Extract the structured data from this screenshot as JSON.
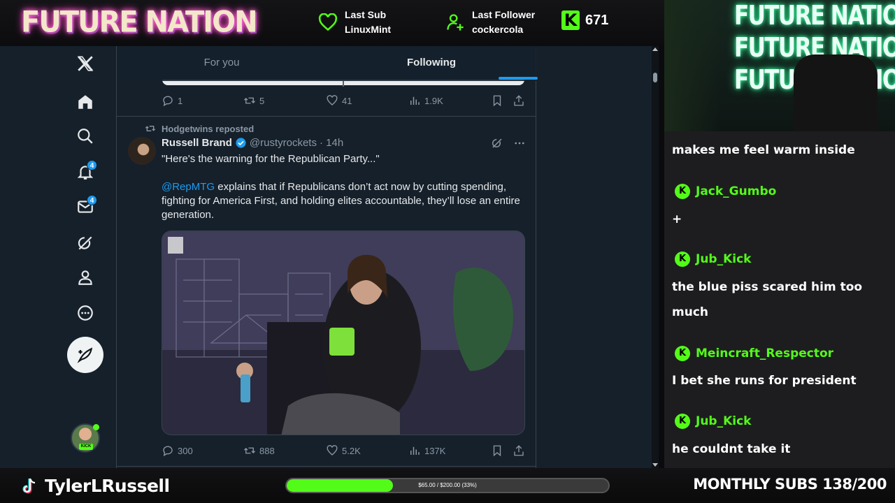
{
  "overlay": {
    "brand": "FUTURE NATION",
    "last_sub_label": "Last Sub",
    "last_sub_name": "LinuxMint",
    "last_follower_label": "Last Follower",
    "last_follower_name": "cockercola",
    "viewer_count": "671",
    "accent_color": "#53fc18"
  },
  "twitter": {
    "tabs": [
      {
        "label": "For you",
        "active": false
      },
      {
        "label": "Following",
        "active": true
      }
    ],
    "nav_icons": [
      "x-logo-icon",
      "home-icon",
      "search-icon",
      "bell-icon",
      "mail-icon",
      "grok-icon",
      "profile-icon",
      "more-icon"
    ],
    "notifications_badge": "4",
    "messages_badge": "4",
    "prev_tweet_stats": {
      "replies": "1",
      "reposts": "5",
      "likes": "41",
      "views": "1.9K"
    },
    "tweet": {
      "reposted_by": "Hodgetwins reposted",
      "author_name": "Russell Brand",
      "author_handle": "@rustyrockets",
      "time": "· 14h",
      "line1": "\"Here's the warning for the Republican Party...\"",
      "mention": "@RepMTG",
      "body": " explains that if Republicans don’t act now by cutting spending, fighting for America First, and holding elites accountable, they’ll lose an entire generation.",
      "stats": {
        "replies": "300",
        "reposts": "888",
        "likes": "5.2K",
        "views": "137K"
      }
    }
  },
  "webcam": {
    "neon_lines": [
      "FUTURE NATION",
      "FUTURE NATION",
      "FUTURE NATION"
    ]
  },
  "chat": {
    "messages": [
      {
        "user": "",
        "text": "makes me feel warm inside"
      },
      {
        "user": "Jack_Gumbo",
        "text": "+"
      },
      {
        "user": "Jub_Kick",
        "text": "the blue piss scared him too"
      },
      {
        "user": "",
        "text": "much"
      },
      {
        "user": "Meincraft_Respector",
        "text": "I bet she runs for president"
      },
      {
        "user": "Jub_Kick",
        "text": "he couldnt take it"
      }
    ]
  },
  "bottom": {
    "streamer_name": "TylerLRussell",
    "goal_label": "$65.00 / $200.00 (33%)",
    "goal_progress": 0.33,
    "monthly_subs": "MONTHLY SUBS 138/200"
  }
}
